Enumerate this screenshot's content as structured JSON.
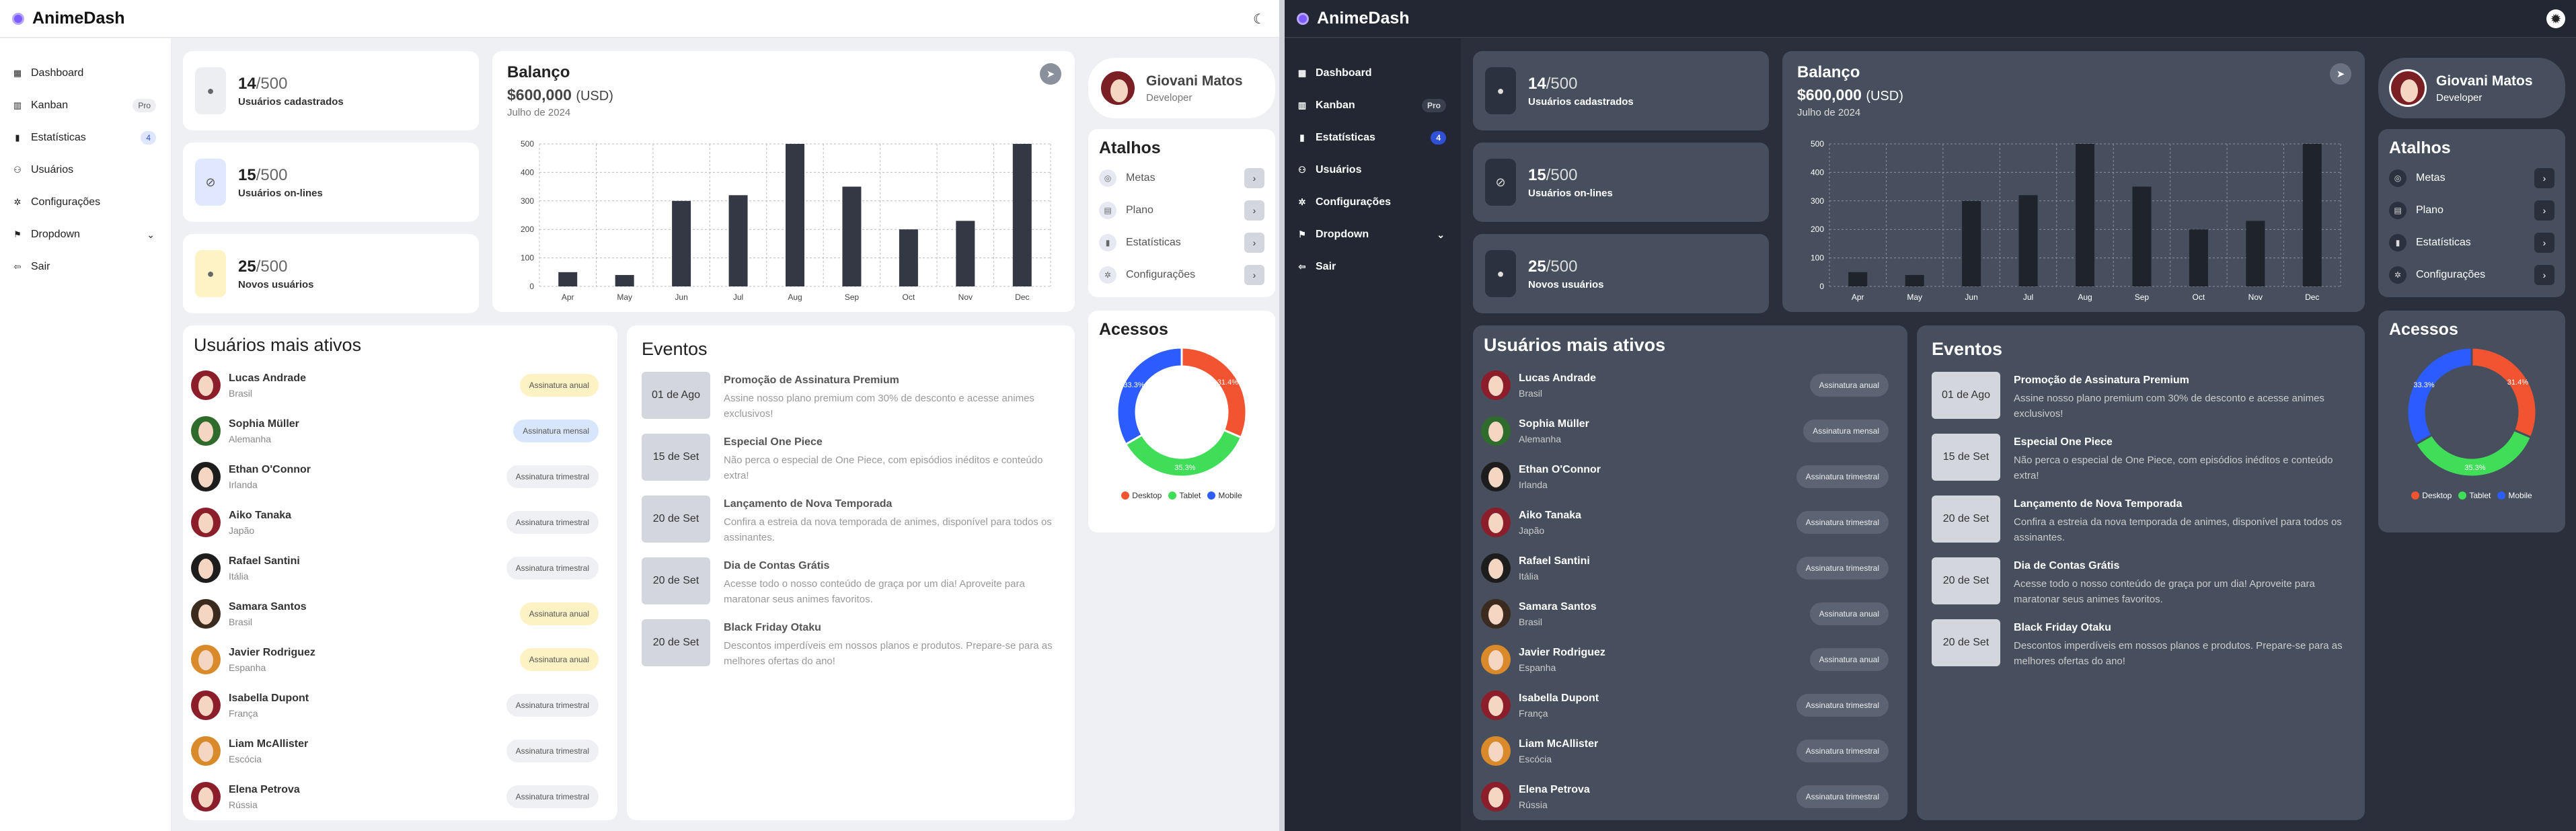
{
  "app": {
    "title": "AnimeDash"
  },
  "nav": [
    {
      "label": "Dashboard",
      "icon": "dashboard-icon",
      "glyph": "▦"
    },
    {
      "label": "Kanban",
      "icon": "kanban-icon",
      "glyph": "▥",
      "badge": "Pro"
    },
    {
      "label": "Estatísticas",
      "icon": "stats-icon",
      "glyph": "▮",
      "badge": "4"
    },
    {
      "label": "Usuários",
      "icon": "users-icon",
      "glyph": "⚇"
    },
    {
      "label": "Configurações",
      "icon": "gear-icon",
      "glyph": "✲"
    },
    {
      "label": "Dropdown",
      "icon": "dropdown-icon",
      "glyph": "⚑"
    },
    {
      "label": "Sair",
      "icon": "logout-icon",
      "glyph": "⇦"
    }
  ],
  "stats": [
    {
      "value": "14",
      "total": "/500",
      "label": "Usuários cadastrados",
      "icon": "user-icon"
    },
    {
      "value": "15",
      "total": "/500",
      "label": "Usuários on-lines",
      "icon": "eye-off-icon"
    },
    {
      "value": "25",
      "total": "/500",
      "label": "Novos usuários",
      "icon": "user-add-icon"
    }
  ],
  "balance": {
    "title": "Balanço",
    "amount": "$600,000",
    "currency": "(USD)",
    "date": "Julho de 2024"
  },
  "chart_data": {
    "type": "bar",
    "categories": [
      "Apr",
      "May",
      "Jun",
      "Jul",
      "Aug",
      "Sep",
      "Oct",
      "Nov",
      "Dec"
    ],
    "values": [
      50,
      40,
      300,
      320,
      500,
      350,
      200,
      230,
      500
    ],
    "ylim": [
      0,
      500
    ],
    "yticks": [
      0,
      100,
      200,
      300,
      400,
      500
    ],
    "grid": true
  },
  "profile": {
    "name": "Giovani Matos",
    "role": "Developer"
  },
  "shortcuts": {
    "title": "Atalhos",
    "items": [
      {
        "label": "Metas",
        "icon": "target-icon",
        "glyph": "◎"
      },
      {
        "label": "Plano",
        "icon": "calendar-icon",
        "glyph": "▤"
      },
      {
        "label": "Estatísticas",
        "icon": "chart-icon",
        "glyph": "▮"
      },
      {
        "label": "Configurações",
        "icon": "gear-icon",
        "glyph": "✲"
      }
    ]
  },
  "access": {
    "title": "Acessos",
    "chart_data": {
      "type": "pie",
      "labels": [
        "Desktop",
        "Tablet",
        "Mobile"
      ],
      "values": [
        31.4,
        35.3,
        33.3
      ],
      "value_labels": [
        "31.4%",
        "35.3%",
        "33.3%"
      ],
      "colors": [
        "#f25330",
        "#3fdd58",
        "#2c5cff"
      ],
      "legend": "bottom"
    }
  },
  "active_users": {
    "title": "Usuários mais ativos",
    "rows": [
      {
        "name": "Lucas Andrade",
        "country": "Brasil",
        "plan": "Assinatura anual",
        "kind": "anual",
        "hair": "#8b1e2a"
      },
      {
        "name": "Sophia Müller",
        "country": "Alemanha",
        "plan": "Assinatura mensal",
        "kind": "mensal",
        "hair": "#2f6b2c"
      },
      {
        "name": "Ethan O'Connor",
        "country": "Irlanda",
        "plan": "Assinatura trimestral",
        "kind": "tri",
        "hair": "#1d1d1d"
      },
      {
        "name": "Aiko Tanaka",
        "country": "Japão",
        "plan": "Assinatura trimestral",
        "kind": "tri",
        "hair": "#8b1e2a"
      },
      {
        "name": "Rafael Santini",
        "country": "Itália",
        "plan": "Assinatura trimestral",
        "kind": "tri",
        "hair": "#1d1d1d"
      },
      {
        "name": "Samara Santos",
        "country": "Brasil",
        "plan": "Assinatura anual",
        "kind": "anual",
        "hair": "#3b2a1e"
      },
      {
        "name": "Javier Rodriguez",
        "country": "Espanha",
        "plan": "Assinatura anual",
        "kind": "anual",
        "hair": "#d98a2b"
      },
      {
        "name": "Isabella Dupont",
        "country": "França",
        "plan": "Assinatura trimestral",
        "kind": "tri",
        "hair": "#8b1e2a"
      },
      {
        "name": "Liam McAllister",
        "country": "Escócia",
        "plan": "Assinatura trimestral",
        "kind": "tri",
        "hair": "#d98a2b"
      },
      {
        "name": "Elena Petrova",
        "country": "Rússia",
        "plan": "Assinatura trimestral",
        "kind": "tri",
        "hair": "#8b1e2a"
      }
    ]
  },
  "events": {
    "title": "Eventos",
    "items": [
      {
        "date": "01 de Ago",
        "title": "Promoção de Assinatura Premium",
        "desc": "Assine nosso plano premium com 30% de desconto e acesse animes exclusivos!"
      },
      {
        "date": "15 de Set",
        "title": "Especial One Piece",
        "desc": "Não perca o especial de One Piece, com episódios inéditos e conteúdo extra!"
      },
      {
        "date": "20 de Set",
        "title": "Lançamento de Nova Temporada",
        "desc": "Confira a estreia da nova temporada de animes, disponível para todos os assinantes."
      },
      {
        "date": "20 de Set",
        "title": "Dia de Contas Grátis",
        "desc": "Acesse todo o nosso conteúdo de graça por um dia! Aproveite para maratonar seus animes favoritos."
      },
      {
        "date": "20 de Set",
        "title": "Black Friday Otaku",
        "desc": "Descontos imperdíveis em nossos planos e produtos. Prepare-se para as melhores ofertas do ano!"
      }
    ]
  }
}
